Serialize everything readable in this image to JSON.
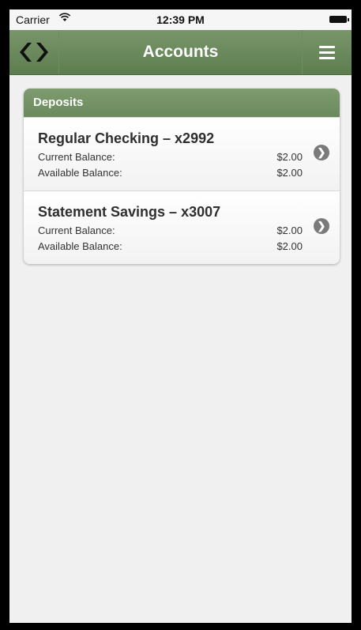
{
  "statusbar": {
    "carrier": "Carrier",
    "time": "12:39 PM"
  },
  "navbar": {
    "title": "Accounts",
    "left_icon": "logo-chevrons-icon",
    "right_icon": "menu-hamburger-icon"
  },
  "section": {
    "title": "Deposits"
  },
  "accounts": [
    {
      "name": "Regular Checking – x2992",
      "current_label": "Current Balance:",
      "current_value": "$2.00",
      "available_label": "Available Balance:",
      "available_value": "$2.00"
    },
    {
      "name": "Statement Savings – x3007",
      "current_label": "Current Balance:",
      "current_value": "$2.00",
      "available_label": "Available Balance:",
      "available_value": "$2.00"
    }
  ],
  "colors": {
    "brand_green": "#6b8a5c",
    "background": "#f0f0f0"
  }
}
